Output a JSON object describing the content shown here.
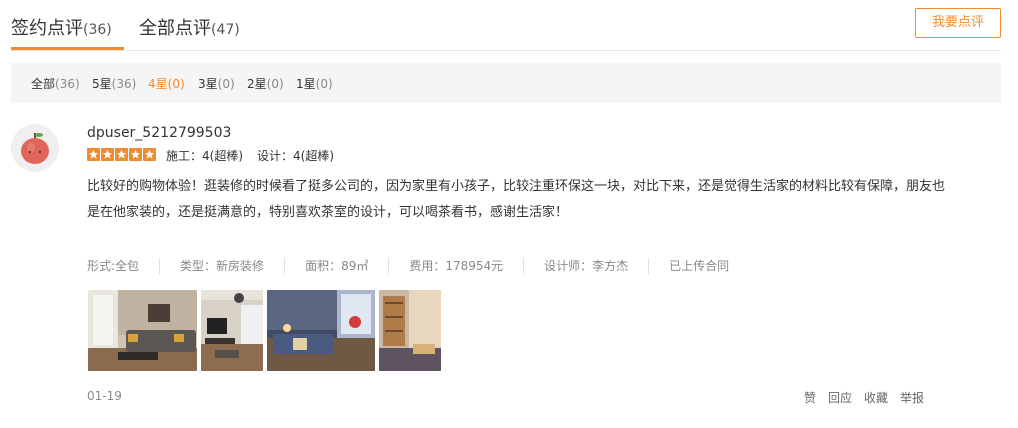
{
  "tabs": [
    {
      "label": "签约点评",
      "count": "(36)"
    },
    {
      "label": "全部点评",
      "count": "(47)"
    }
  ],
  "write_button": "我要点评",
  "filters": [
    {
      "label": "全部",
      "count": "(36)"
    },
    {
      "label": "5星",
      "count": "(36)"
    },
    {
      "label": "4星",
      "count": "(0)"
    },
    {
      "label": "3星",
      "count": "(0)"
    },
    {
      "label": "2星",
      "count": "(0)"
    },
    {
      "label": "1星",
      "count": "(0)"
    }
  ],
  "active_filter_index": 2,
  "accent_color": "#f08c30",
  "review": {
    "avatar_icon": "apple-icon",
    "username": "dpuser_5212799503",
    "stars": 5,
    "construction_rating": "施工：4(超棒)",
    "design_rating": "设计：4(超棒)",
    "text": "比较好的购物体验！逛装修的时候看了挺多公司的，因为家里有小孩子，比较注重环保这一块，对比下来，还是觉得生活家的材料比较有保障，朋友也是在他家装的，还是挺满意的，特别喜欢茶室的设计，可以喝茶看书，感谢生活家！",
    "meta": {
      "form": "形式:全包",
      "type": "类型：新房装修",
      "area": "面积：89㎡",
      "cost": "费用：178954元",
      "designer": "设计师：李方杰",
      "contract": "已上传合同"
    },
    "photos": [
      "living-room-photo",
      "living-room-tv-photo",
      "bedroom-photo",
      "tea-room-photo"
    ],
    "date": "01-19",
    "actions": {
      "like": "赞",
      "reply": "回应",
      "favorite": "收藏",
      "report": "举报"
    }
  }
}
